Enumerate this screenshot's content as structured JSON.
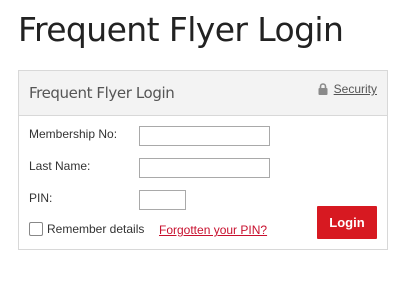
{
  "page": {
    "title": "Frequent Flyer Login"
  },
  "panel": {
    "title": "Frequent Flyer Login",
    "security_link": "Security",
    "security_icon": "lock-icon"
  },
  "form": {
    "membership_label": "Membership No:",
    "membership_value": "",
    "last_name_label": "Last Name:",
    "last_name_value": "",
    "pin_label": "PIN:",
    "pin_value": "",
    "remember_label": "Remember details",
    "remember_checked": false,
    "forgot_link": "Forgotten your PIN?",
    "login_button": "Login"
  },
  "colors": {
    "accent": "#d71921",
    "link": "#c8102e",
    "header_bg": "#f3f3f3",
    "border": "#d8d8d8"
  }
}
